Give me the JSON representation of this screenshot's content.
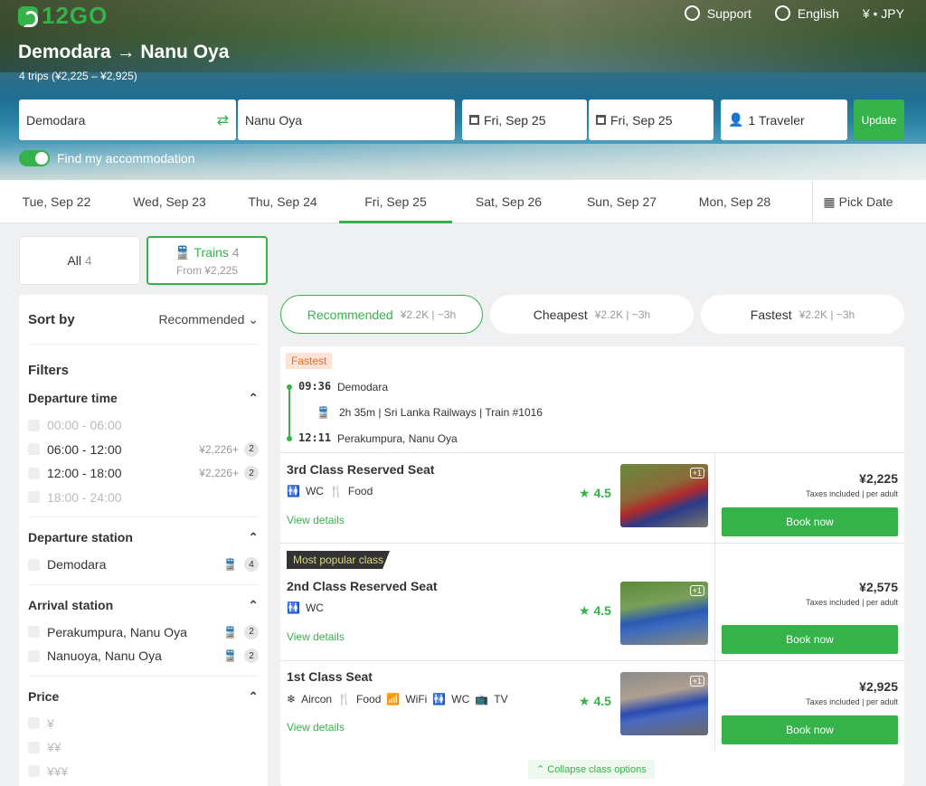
{
  "brand": {
    "logo": "12GO",
    "accent": "#35b34a"
  },
  "nav": {
    "support": "Support",
    "language": "English",
    "currency": "¥ • JPY"
  },
  "route": {
    "title": "Demodara → Nanu Oya",
    "subtitle": "4 trips (¥2,225 – ¥2,925)"
  },
  "search": {
    "from": "Demodara",
    "to": "Nanu Oya",
    "depart": "Fri, Sep 25",
    "return": "Fri, Sep 25",
    "travelers": "1 Traveler",
    "update": "Update",
    "accommodation": "Find my accommodation"
  },
  "date_tabs": [
    "Tue, Sep 22",
    "Wed, Sep 23",
    "Thu, Sep 24",
    "Fri, Sep 25",
    "Sat, Sep 26",
    "Sun, Sep 27",
    "Mon, Sep 28"
  ],
  "pick_date": "Pick Date",
  "modes": {
    "all": {
      "label": "All",
      "count": "4"
    },
    "trains": {
      "label": "Trains",
      "count": "4",
      "from": "From ¥2,225"
    }
  },
  "sidebar": {
    "sort_label": "Sort by",
    "sort_value": "Recommended",
    "filters": "Filters",
    "departure_time": {
      "title": "Departure time",
      "options": [
        {
          "label": "00:00 - 06:00",
          "price": "",
          "count": ""
        },
        {
          "label": "06:00 - 12:00",
          "price": "¥2,226+",
          "count": "2"
        },
        {
          "label": "12:00 - 18:00",
          "price": "¥2,226+",
          "count": "2"
        },
        {
          "label": "18:00 - 24:00",
          "price": "",
          "count": ""
        }
      ]
    },
    "departure_station": {
      "title": "Departure station",
      "options": [
        {
          "label": "Demodara",
          "count": "4"
        }
      ]
    },
    "arrival_station": {
      "title": "Arrival station",
      "options": [
        {
          "label": "Perakumpura, Nanu Oya",
          "count": "2"
        },
        {
          "label": "Nanuoya, Nanu Oya",
          "count": "2"
        }
      ]
    },
    "price": {
      "title": "Price",
      "options": [
        "¥",
        "¥¥",
        "¥¥¥"
      ]
    }
  },
  "sort_pills": [
    {
      "label": "Recommended",
      "sub": "¥2.2K | ~3h"
    },
    {
      "label": "Cheapest",
      "sub": "¥2.2K | ~3h"
    },
    {
      "label": "Fastest",
      "sub": "¥2.2K | ~3h"
    }
  ],
  "trip": {
    "tag": "Fastest",
    "depart_time": "09:36",
    "depart_station": "Demodara",
    "operator": "2h 35m | Sri Lanka Railways | Train #1016",
    "arrive_time": "12:11",
    "arrive_station": "Perakumpura, Nanu Oya",
    "popular_tag": "Most popular class",
    "view_details": "View details",
    "taxes": "Taxes included | per adult",
    "book": "Book now",
    "photo_more": "+1",
    "collapse": "Collapse class options",
    "classes": [
      {
        "name": "3rd Class Reserved Seat",
        "amenities": [
          "WC",
          "Food"
        ],
        "rating": "4.5",
        "price": "¥2,225"
      },
      {
        "name": "2nd Class Reserved Seat",
        "amenities": [
          "WC"
        ],
        "rating": "4.5",
        "price": "¥2,575"
      },
      {
        "name": "1st Class Seat",
        "amenities": [
          "Aircon",
          "Food",
          "WiFi",
          "WC",
          "TV"
        ],
        "rating": "4.5",
        "price": "¥2,925"
      }
    ]
  }
}
